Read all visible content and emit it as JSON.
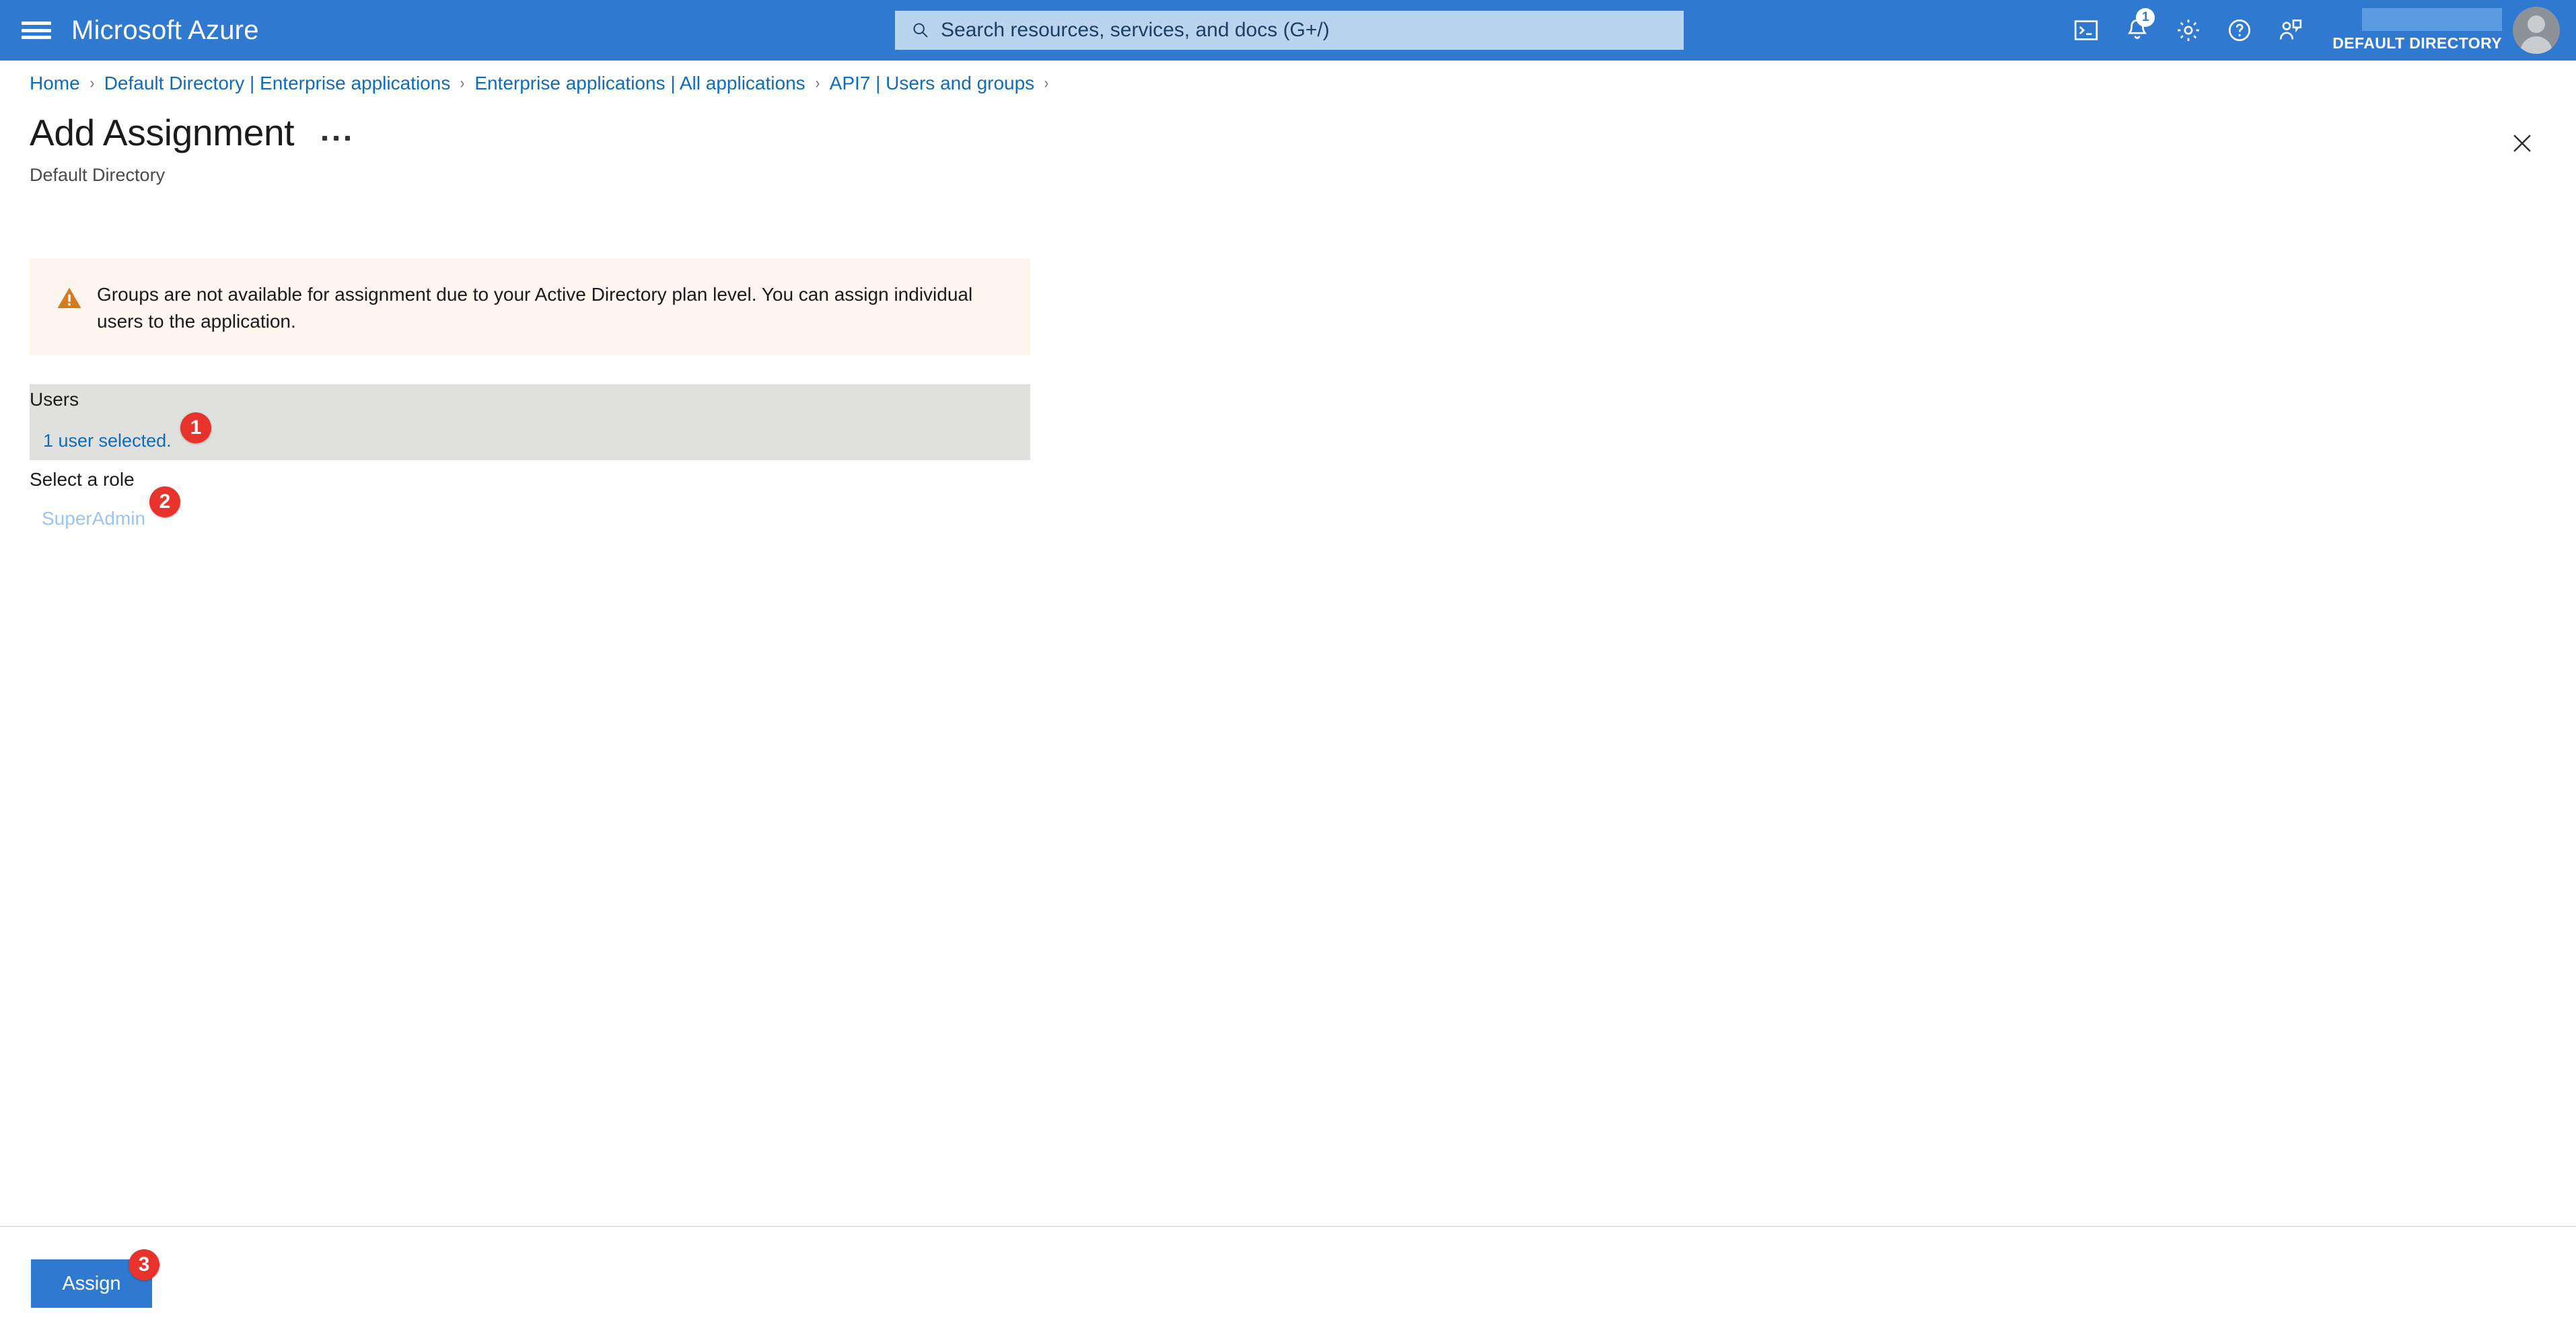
{
  "topbar": {
    "menu_icon": "hamburger-icon",
    "brand": "Microsoft Azure",
    "search": {
      "icon": "search-icon",
      "placeholder": "Search resources, services, and docs (G+/)",
      "value": ""
    },
    "icons": [
      {
        "name": "cloud-shell-icon",
        "label": "Cloud Shell"
      },
      {
        "name": "notifications-icon",
        "label": "Notifications",
        "badge": "1"
      },
      {
        "name": "gear-icon",
        "label": "Settings"
      },
      {
        "name": "help-icon",
        "label": "Help"
      },
      {
        "name": "feedback-icon",
        "label": "Feedback"
      }
    ],
    "account": {
      "name_redacted": "",
      "directory": "DEFAULT DIRECTORY",
      "avatar": "user-avatar"
    }
  },
  "breadcrumb": {
    "separator": "›",
    "items": [
      "Home",
      "Default Directory | Enterprise applications",
      "Enterprise applications | All applications",
      "API7 | Users and groups"
    ]
  },
  "blade": {
    "title": "Add Assignment",
    "subtitle": "Default Directory",
    "more_menu": "···",
    "close_icon": "close-icon"
  },
  "warning": {
    "icon": "warning-triangle-icon",
    "text": "Groups are not available for assignment due to your Active Directory plan level. You can assign individual users to the application.",
    "background": "#fdf6ef",
    "icon_color": "#d67a1e"
  },
  "form": {
    "users_label": "Users",
    "users_value": "1 user selected.",
    "role_label": "Select a role",
    "role_value": "SuperAdmin"
  },
  "actions": {
    "assign_label": "Assign"
  },
  "steps": [
    {
      "number": "1",
      "target": "users-selected-link"
    },
    {
      "number": "2",
      "target": "role-value"
    },
    {
      "number": "3",
      "target": "assign-button"
    }
  ],
  "colors": {
    "header_blue": "#2f7ad0",
    "link_blue": "#0f6cbd",
    "step_red": "#e8322c",
    "field_gray": "#e0e0de",
    "warning_bg": "#fdf6ef"
  }
}
